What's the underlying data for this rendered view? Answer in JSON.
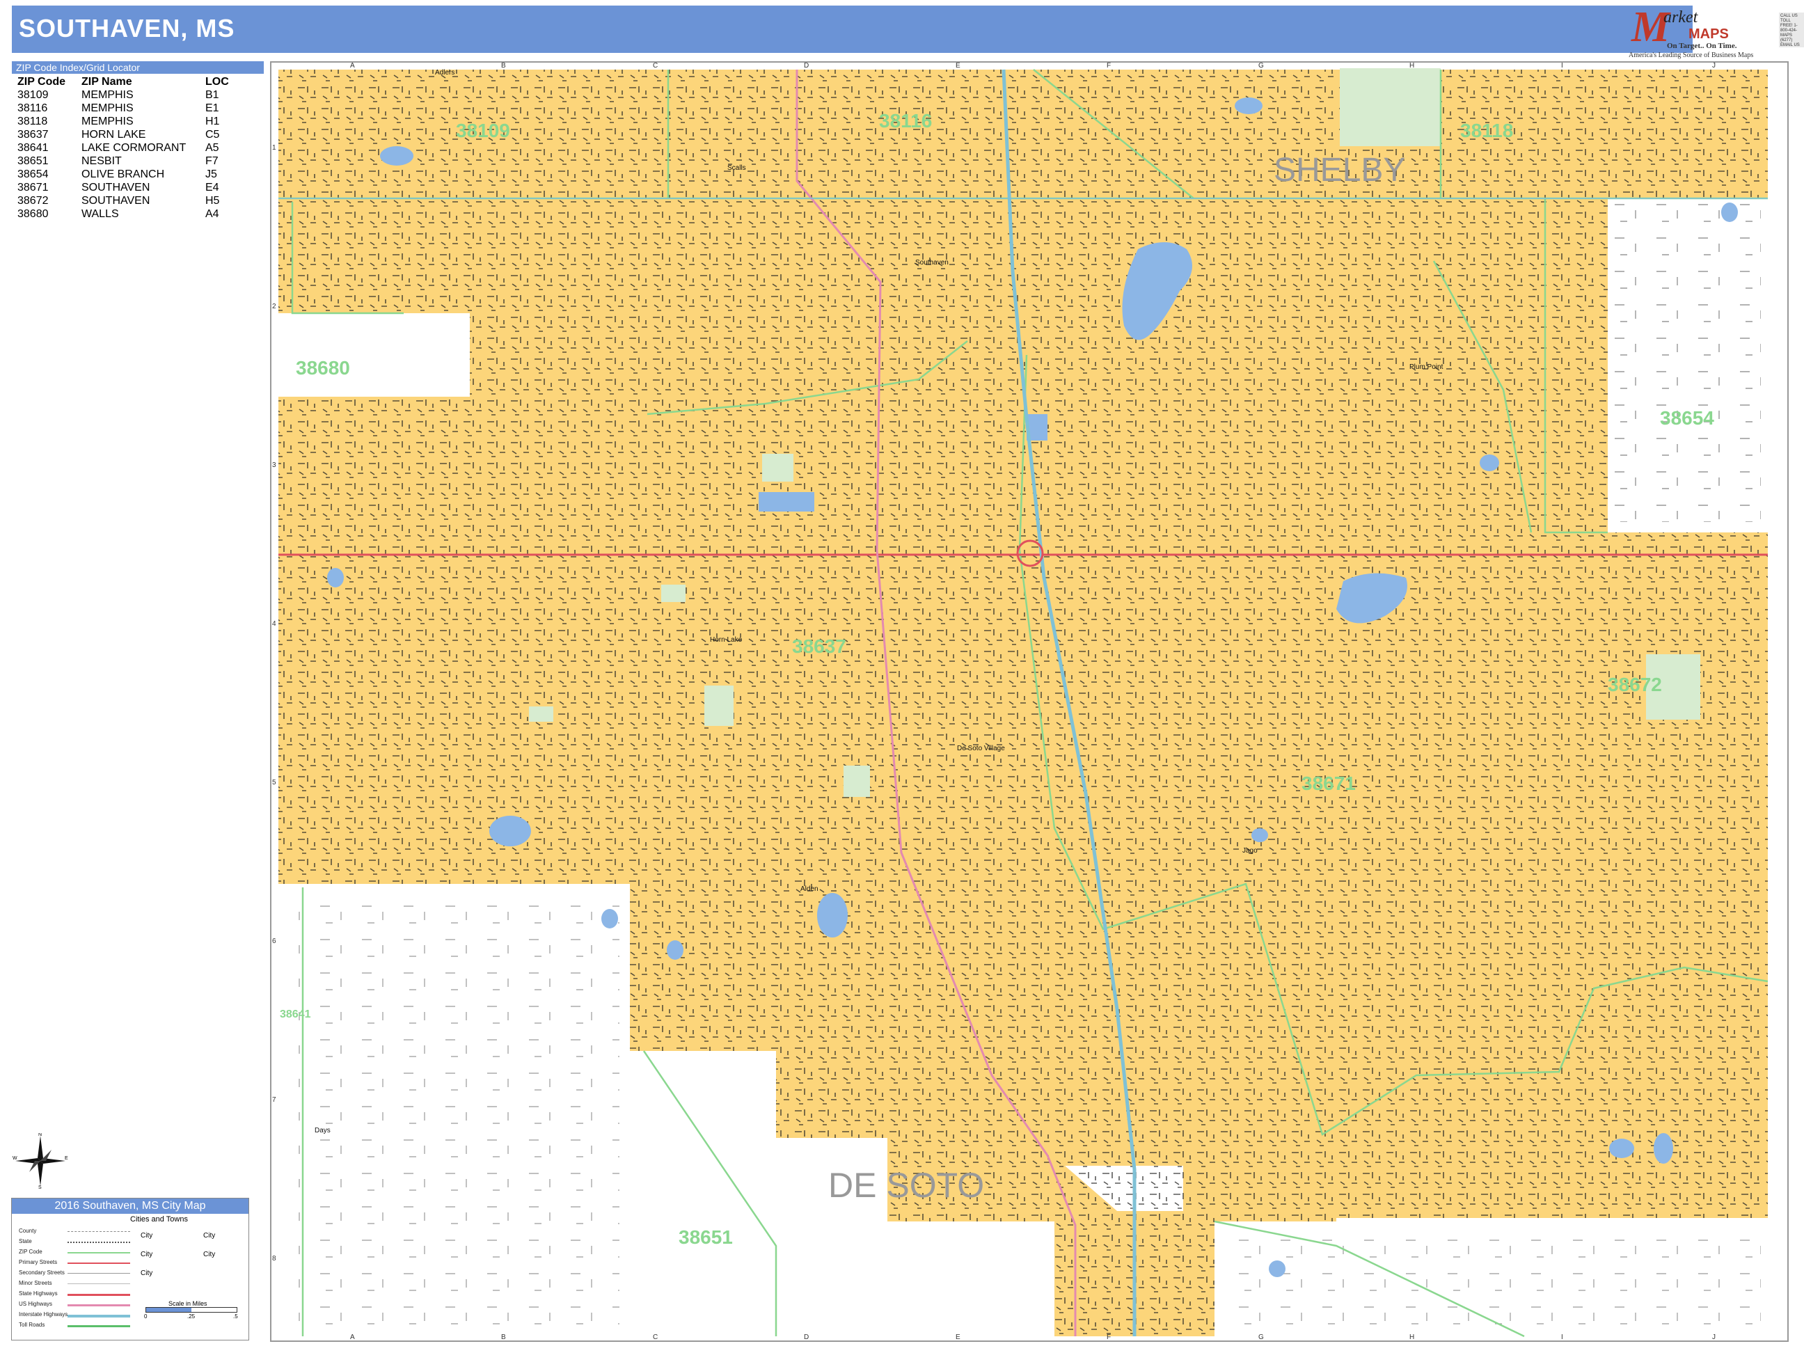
{
  "header": {
    "title": "SOUTHAVEN, MS"
  },
  "logo": {
    "brand_initial": "M",
    "brand_word1": "arket",
    "brand_word2": "MAPS",
    "tagline": "On Target.. On Time.",
    "source_line": "America's Leading Source of Business Maps",
    "contact": "CALL US TOLL FREE! 1-800-424-MAPS (6277) EMAIL US AT: requests@MarketMAPS.com"
  },
  "zip_index": {
    "title": "ZIP Code Index/Grid Locator",
    "columns": [
      "ZIP Code",
      "ZIP Name",
      "LOC"
    ],
    "rows": [
      [
        "38109",
        "MEMPHIS",
        "B1"
      ],
      [
        "38116",
        "MEMPHIS",
        "E1"
      ],
      [
        "38118",
        "MEMPHIS",
        "H1"
      ],
      [
        "38637",
        "HORN LAKE",
        "C5"
      ],
      [
        "38641",
        "LAKE CORMORANT",
        "A5"
      ],
      [
        "38651",
        "NESBIT",
        "F7"
      ],
      [
        "38654",
        "OLIVE BRANCH",
        "J5"
      ],
      [
        "38671",
        "SOUTHAVEN",
        "E4"
      ],
      [
        "38672",
        "SOUTHAVEN",
        "H5"
      ],
      [
        "38680",
        "WALLS",
        "A4"
      ]
    ]
  },
  "map": {
    "grid_columns": [
      "A",
      "B",
      "C",
      "D",
      "E",
      "F",
      "G",
      "H",
      "I",
      "J"
    ],
    "grid_rows": [
      "1",
      "2",
      "3",
      "4",
      "5",
      "6",
      "7",
      "8"
    ],
    "counties": [
      "SHELBY",
      "DE SOTO"
    ],
    "zip_labels": [
      "38109",
      "38116",
      "38118",
      "38680",
      "38654",
      "38637",
      "38672",
      "38671",
      "38641",
      "38651"
    ],
    "place_labels": [
      "Southaven",
      "Horn Lake",
      "Plum Point",
      "De Soto Village",
      "Alden",
      "Jago",
      "Days",
      "Scalls",
      "Adlers"
    ],
    "colors": {
      "city_fill": "#fcd57a",
      "water": "#8cb6e6",
      "park": "#d7ecd0",
      "zip_boundary": "#8ad78f",
      "zip_label": "#8ad78f",
      "state_highway": "#e0505c",
      "us_highway": "#e38ab0",
      "interstate": "#7fc1d6",
      "county_label": "#999999"
    }
  },
  "compass": {
    "n": "N",
    "s": "S",
    "e": "E",
    "w": "W"
  },
  "legend": {
    "title": "2016 Southaven, MS City Map",
    "cities_title": "Cities and Towns",
    "items": [
      "County",
      "State",
      "ZIP Code",
      "Primary Streets",
      "Secondary Streets",
      "Minor Streets",
      "State Highways",
      "US Highways",
      "Interstate Highways",
      "Toll Roads"
    ],
    "city_marker": "City",
    "scale_title": "Scale in Miles",
    "scale_labels": [
      "0",
      ".25",
      ".5"
    ],
    "colors": {
      "state": "#555555",
      "zip": "#8ad78f",
      "primary": "#e0505c",
      "secondary": "#999999",
      "minor": "#bbbbbb",
      "state_hwy": "#e0505c",
      "us_hwy": "#e38ab0",
      "interstate": "#7fc1d6",
      "toll": "#5bbf6a"
    }
  }
}
